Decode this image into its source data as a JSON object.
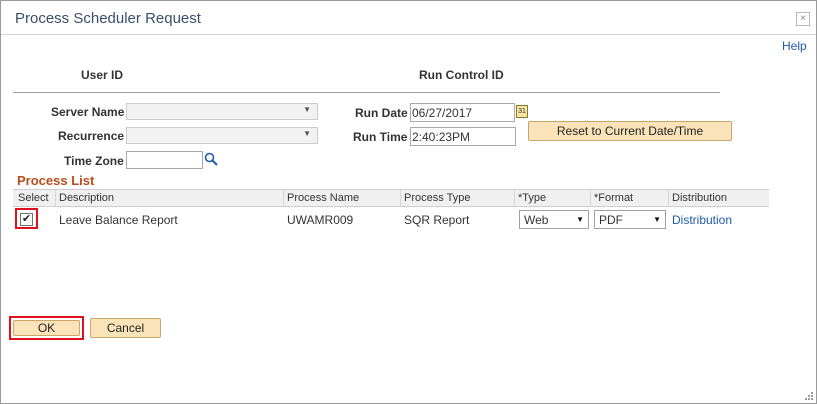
{
  "dialog": {
    "title": "Process Scheduler Request",
    "close_glyph": "×",
    "help_label": "Help"
  },
  "header": {
    "user_id_label": "User ID",
    "run_control_id_label": "Run Control ID"
  },
  "form": {
    "server_name_label": "Server Name",
    "server_name_value": "",
    "recurrence_label": "Recurrence",
    "recurrence_value": "",
    "time_zone_label": "Time Zone",
    "time_zone_value": "",
    "run_date_label": "Run Date",
    "run_date_value": "06/27/2017",
    "run_time_label": "Run Time",
    "run_time_value": "2:40:23PM",
    "reset_button_label": "Reset to Current Date/Time"
  },
  "process_list": {
    "title": "Process List",
    "columns": [
      "Select",
      "Description",
      "Process Name",
      "Process Type",
      "*Type",
      "*Format",
      "Distribution"
    ],
    "rows": [
      {
        "selected": true,
        "description": "Leave Balance Report",
        "process_name": "UWAMR009",
        "process_type": "SQR Report",
        "type": "Web",
        "format": "PDF",
        "distribution": "Distribution"
      }
    ]
  },
  "footer": {
    "ok_label": "OK",
    "cancel_label": "Cancel"
  },
  "icons": {
    "calendar": "calendar-icon",
    "search": "search-icon",
    "close": "close-icon",
    "dropdown": "chevron-down-icon",
    "resize": "resize-grip-icon"
  },
  "colors": {
    "title_text": "#3b4e6b",
    "link": "#1f5bab",
    "section_title": "#b84c1a",
    "button_bg": "#fbe3b9",
    "highlight_border": "#e0101e"
  }
}
